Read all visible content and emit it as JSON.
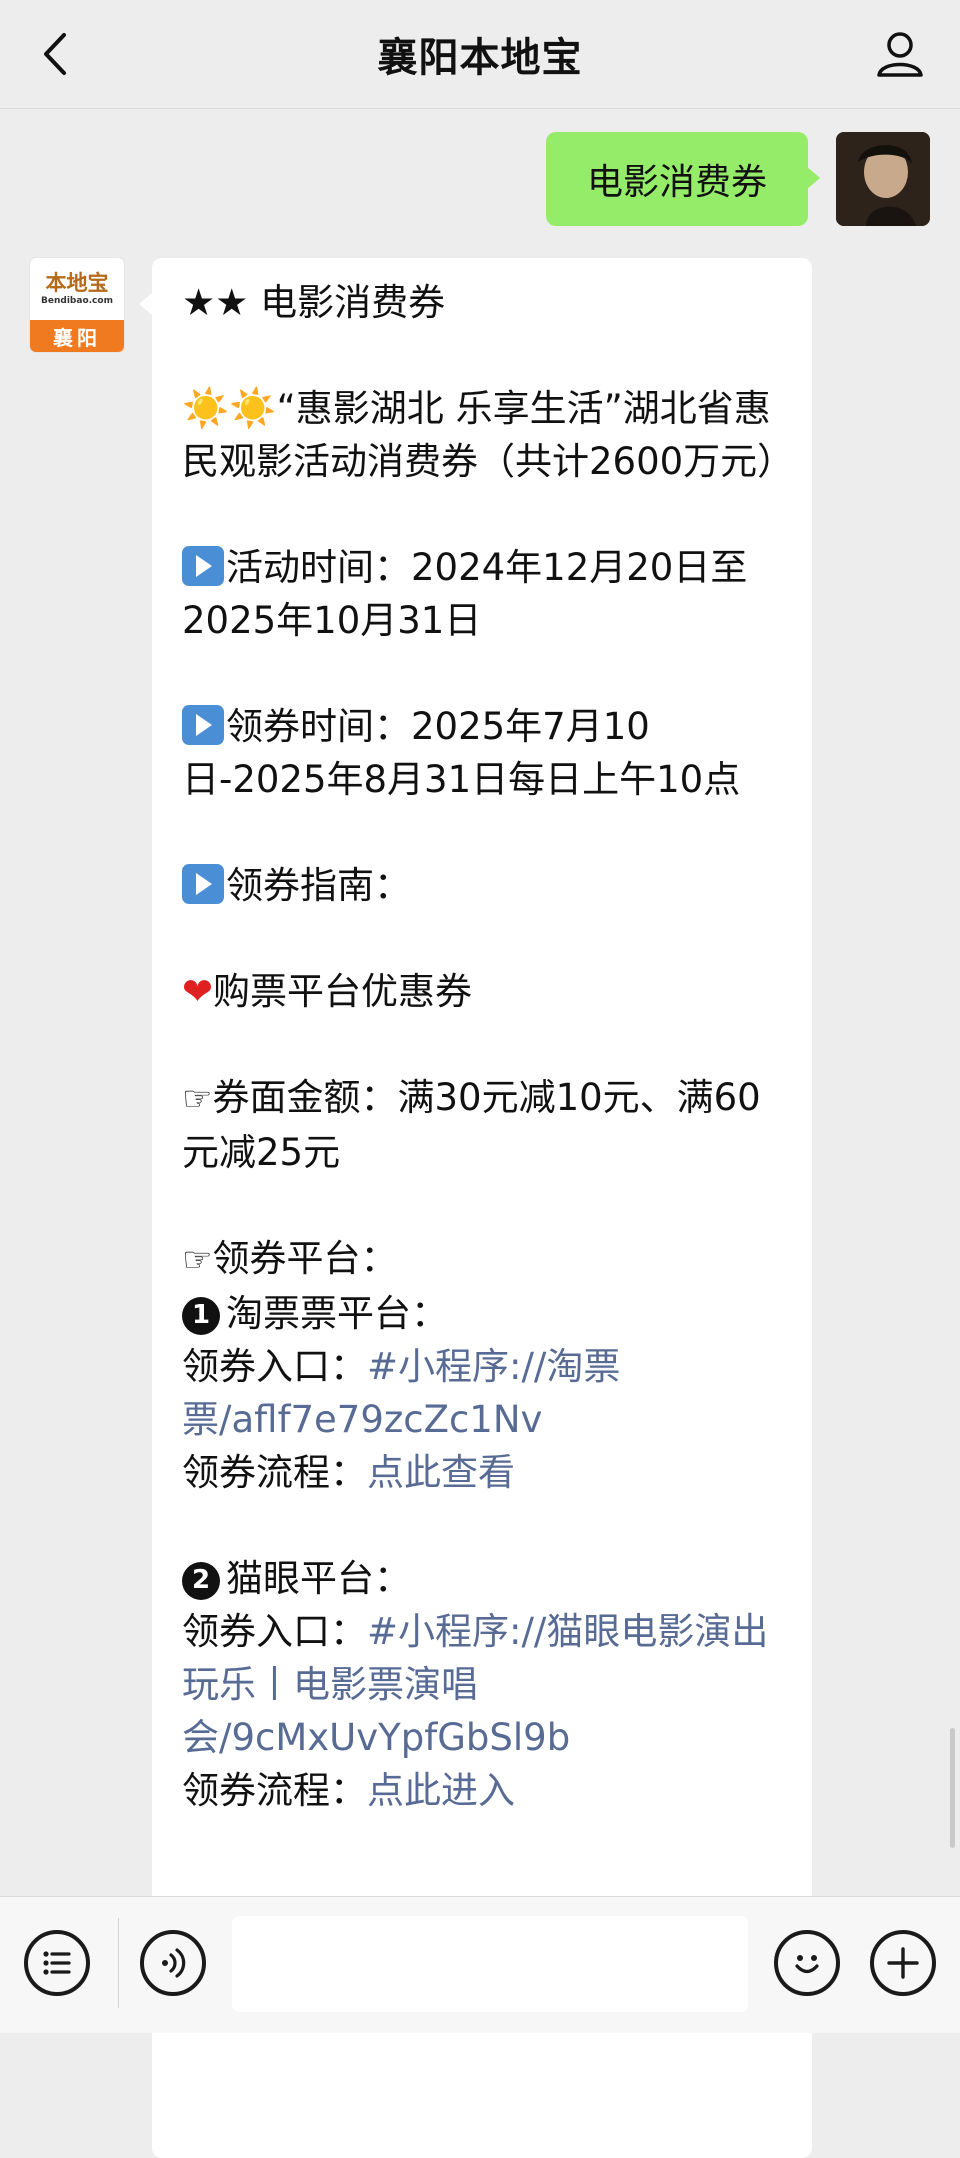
{
  "header": {
    "title": "襄阳本地宝"
  },
  "sent_message": {
    "text": "电影消费券"
  },
  "bot": {
    "logo_main": "本地宝",
    "logo_site": "Bendibao.com",
    "logo_city": "襄阳"
  },
  "message": {
    "title": "★★ 电影消费券",
    "sun_icons": "☀️☀️",
    "intro": "“惠影湖北 乐享生活”湖北省惠民观影活动消费券（共计2600万元）",
    "activity_time": "活动时间：2024年12月20日至2025年10月31日",
    "claim_time": "领券时间：2025年7月10日-2025年8月31日每日上午10点",
    "guide": "领券指南：",
    "platform_coupon": "购票平台优惠券",
    "coupon_amount": "券面金额：满30元减10元、满60元减25元",
    "platforms_label": "领券平台：",
    "p1_num": "1",
    "p1_name": "淘票票平台：",
    "p1_entry_label": "领券入口：",
    "p1_entry_link": "#小程序://淘票票/aflf7e79zcZc1Nv",
    "p1_flow_label": "领券流程：",
    "p1_flow_link": "点此查看",
    "p2_num": "2",
    "p2_name": "猫眼平台：",
    "p2_entry_label": "领券入口：",
    "p2_entry_link": "#小程序://猫眼电影演出玩乐丨电影票演唱会/9cMxUvYpfGbSl9b",
    "p2_flow_label": "领券流程：",
    "p2_flow_link": "点此进入"
  },
  "icons": {
    "back": "chevron-left-icon",
    "profile": "person-icon",
    "menu": "list-icon",
    "voice": "voice-icon",
    "emoji": "emoji-icon",
    "plus": "plus-icon"
  },
  "colors": {
    "sent_bubble": "#95ec69",
    "link": "#576b95",
    "play_icon": "#4a8fd6",
    "logo_orange": "#f07a1f"
  }
}
